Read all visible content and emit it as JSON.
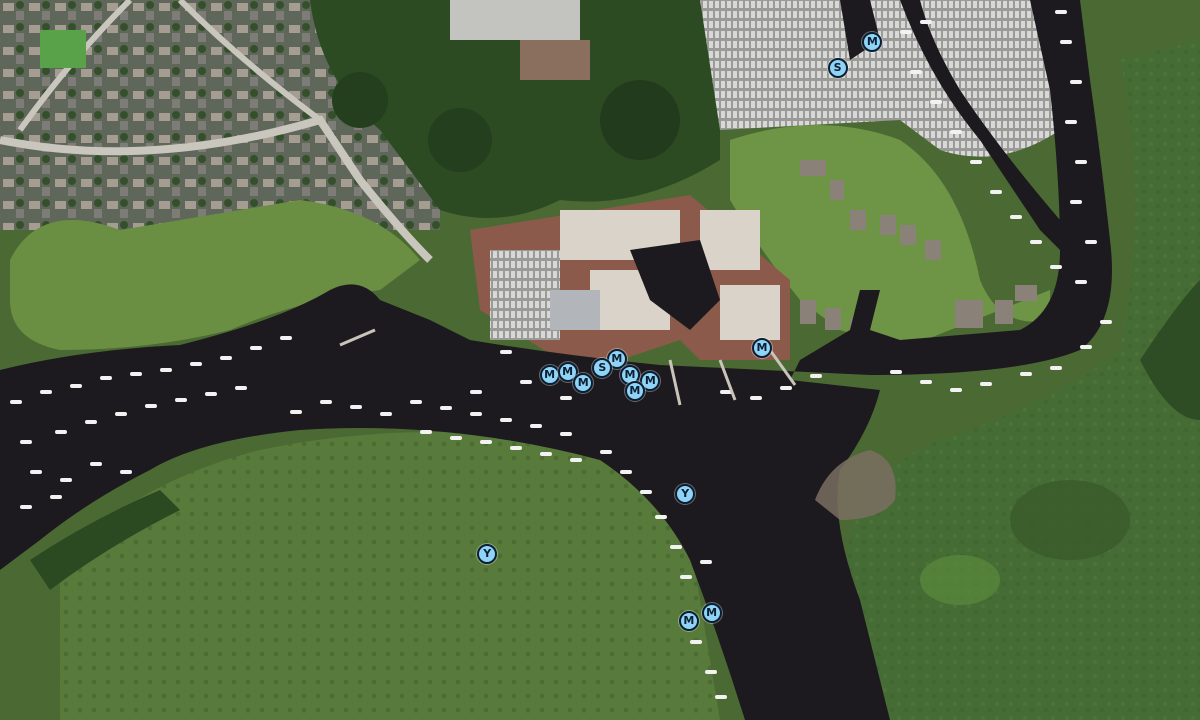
{
  "colors": {
    "marker_fill": "#8fd3f7",
    "marker_outline": "#0b1f33",
    "water": "#1c1a1e",
    "marsh": "#4c6b34",
    "marsh_east": "#3f6530",
    "urban": "#6d6d63",
    "woodland": "#2a4a22",
    "boat": "#f2f2f2"
  },
  "markers": [
    {
      "type": "harbour-master",
      "symbol": "S",
      "lat": 0.095,
      "lon": 0.698
    },
    {
      "type": "marina",
      "symbol": "M",
      "lat": 0.058,
      "lon": 0.727
    },
    {
      "type": "marina",
      "symbol": "M",
      "lat": 0.521,
      "lon": 0.458
    },
    {
      "type": "marina",
      "symbol": "M",
      "lat": 0.517,
      "lon": 0.473
    },
    {
      "type": "marina",
      "symbol": "M",
      "lat": 0.532,
      "lon": 0.486
    },
    {
      "type": "marina",
      "symbol": "M",
      "lat": 0.499,
      "lon": 0.514
    },
    {
      "type": "harbour-master",
      "symbol": "S",
      "lat": 0.511,
      "lon": 0.502
    },
    {
      "type": "marina",
      "symbol": "M",
      "lat": 0.521,
      "lon": 0.525
    },
    {
      "type": "marina",
      "symbol": "M",
      "lat": 0.529,
      "lon": 0.542
    },
    {
      "type": "marina",
      "symbol": "M",
      "lat": 0.543,
      "lon": 0.529
    },
    {
      "type": "marina",
      "symbol": "M",
      "lat": 0.483,
      "lon": 0.635
    },
    {
      "type": "yacht-club",
      "symbol": "Y",
      "lat": 0.686,
      "lon": 0.571
    },
    {
      "type": "yacht-club",
      "symbol": "Y",
      "lat": 0.769,
      "lon": 0.406
    },
    {
      "type": "marina",
      "symbol": "M",
      "lat": 0.851,
      "lon": 0.593
    },
    {
      "type": "marina",
      "symbol": "M",
      "lat": 0.863,
      "lon": 0.574
    }
  ]
}
